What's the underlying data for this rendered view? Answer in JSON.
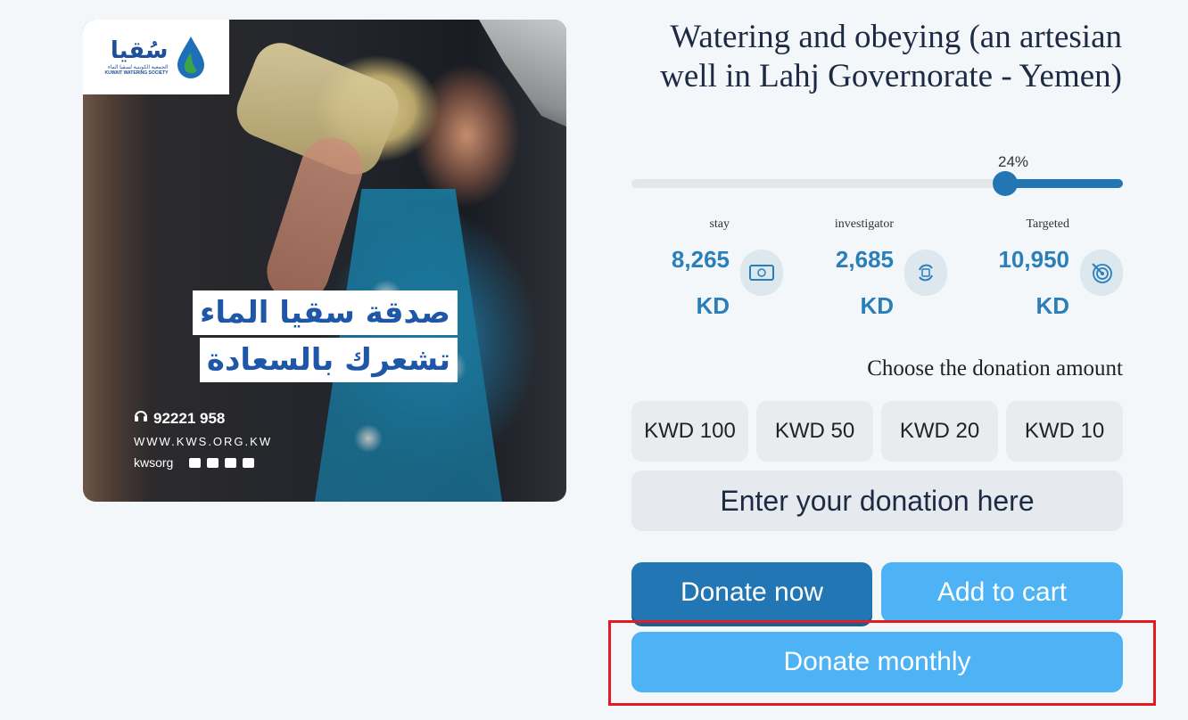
{
  "hero": {
    "logo": {
      "arabic": "سُقيا",
      "subtitle_ar": "الجمعية الكويتية لسقيا الماء",
      "subtitle_en": "KUWAIT WATERING SOCIETY"
    },
    "slogan_line1": "صدقة سقيا الماء",
    "slogan_line2": "تشعرك بالسعادة",
    "phone": "92221 958",
    "website": "WWW.KWS.ORG.KW",
    "handle": "kwsorg",
    "social_icons": [
      "facebook-icon",
      "instagram-icon",
      "twitter-icon",
      "youtube-icon"
    ]
  },
  "project": {
    "title": "Watering and obeying (an artesian well in Lahj Governorate - Yemen)",
    "progress_label": "24%",
    "progress_fraction": 0.24
  },
  "stats": [
    {
      "label": "stay",
      "value": "8,265",
      "unit": "KD",
      "icon": "cash-icon"
    },
    {
      "label": "investigator",
      "value": "2,685",
      "unit": "KD",
      "icon": "exchange-icon"
    },
    {
      "label": "Targeted",
      "value": "10,950",
      "unit": "KD",
      "icon": "target-icon"
    }
  ],
  "donation": {
    "choose_label": "Choose the donation amount",
    "amounts": [
      "KWD 100",
      "KWD 50",
      "KWD 20",
      "KWD 10"
    ],
    "custom_placeholder": "Enter your donation here"
  },
  "actions": {
    "donate_now": "Donate now",
    "add_to_cart": "Add to cart",
    "donate_monthly": "Donate monthly"
  },
  "colors": {
    "primary": "#2176b3",
    "secondary": "#4db3f5",
    "stat_text": "#2a7fba",
    "highlight": "#e31b23"
  }
}
